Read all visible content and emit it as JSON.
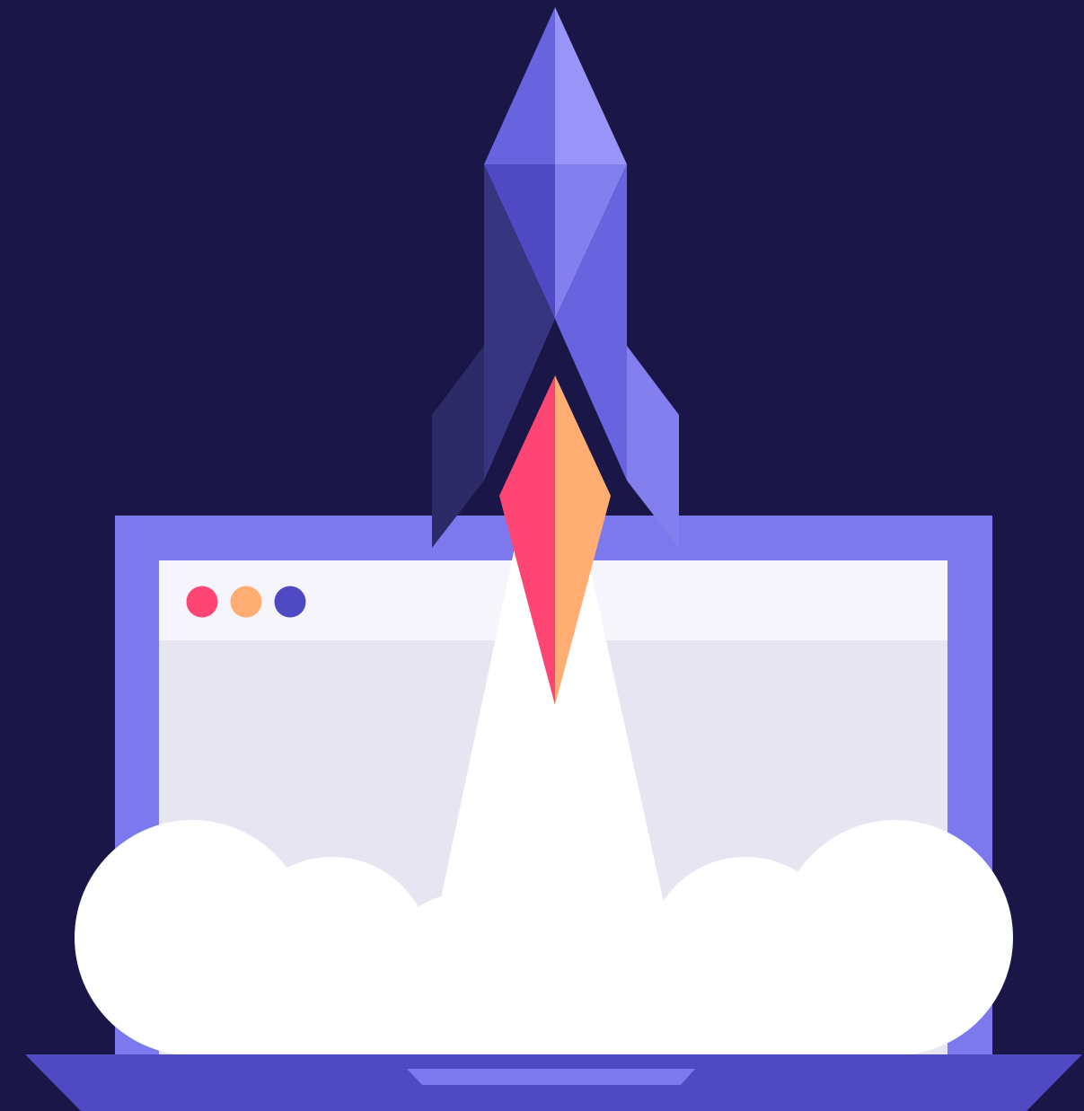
{
  "illustration": {
    "subject": "rocket-launching-from-laptop",
    "colors": {
      "background": "#1a1748",
      "laptop_frame": "#7c78ee",
      "laptop_base": "#4f4ac4",
      "trackpad": "#7c78ee",
      "screen_titlebar": "#f6f5fb",
      "screen_body": "#e6e5f1",
      "rocket_nose_left": "#6863de",
      "rocket_nose_right": "#9995f8",
      "rocket_body_dark": "#4f4ac4",
      "rocket_body_light": "#847fee",
      "rocket_fin_left": "#2d2a68",
      "rocket_fin_left_inner": "#373480",
      "rocket_fin_right": "#847fee",
      "rocket_fin_right_inner": "#6863de",
      "flame_left": "#ff4574",
      "flame_right": "#ffad72",
      "smoke": "#ffffff"
    },
    "window_dots": [
      {
        "name": "red-dot",
        "color": "#ff4574"
      },
      {
        "name": "orange-dot",
        "color": "#ffad72"
      },
      {
        "name": "blue-dot",
        "color": "#4f4ac4"
      }
    ]
  }
}
